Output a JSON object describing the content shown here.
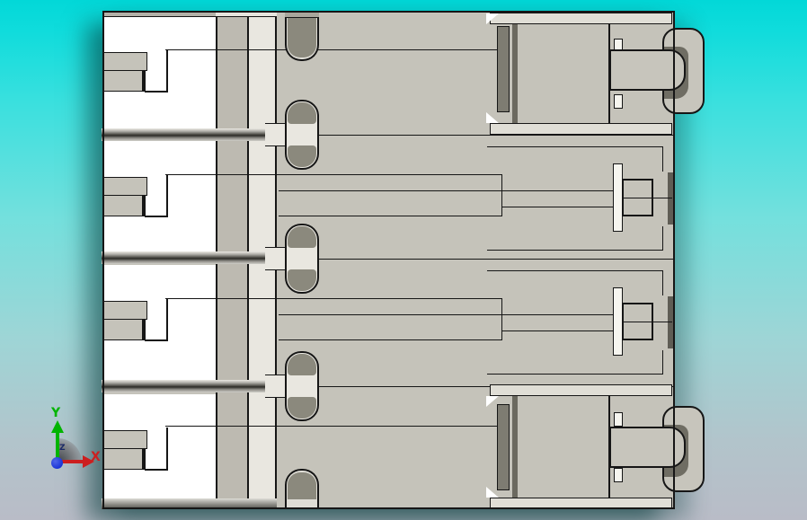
{
  "app": {
    "type": "cad-3d-viewport",
    "description": "Section view of a multi-cavity connector housing on a cyan gradient viewport"
  },
  "triad": {
    "x_label": "X",
    "y_label": "Y",
    "z_label": "Z"
  },
  "part": {
    "name": "connector-housing-section",
    "slot_count": 5,
    "units": [
      {
        "id": 1,
        "right_feature": "latch-hook"
      },
      {
        "id": 2,
        "right_feature": "t-bar"
      },
      {
        "id": 3,
        "right_feature": "t-bar"
      },
      {
        "id": 4,
        "right_feature": "latch-hook"
      }
    ]
  },
  "colors": {
    "background_top": "#02d8d8",
    "background_bottom": "#b9bcc7",
    "body": "#c5c3ba",
    "column": "#bdbab1",
    "light": "#e9e7e0",
    "cell": "#ffffff",
    "dark_slot": "#8b897d",
    "cavity": "#6f6d63",
    "contact": "#7e7c72",
    "band": "#e0ded6",
    "outline": "#161616",
    "axis_x": "#cc1f1f",
    "axis_y": "#00b400",
    "axis_z": "#1b2a66",
    "origin": "#1b35d6"
  }
}
